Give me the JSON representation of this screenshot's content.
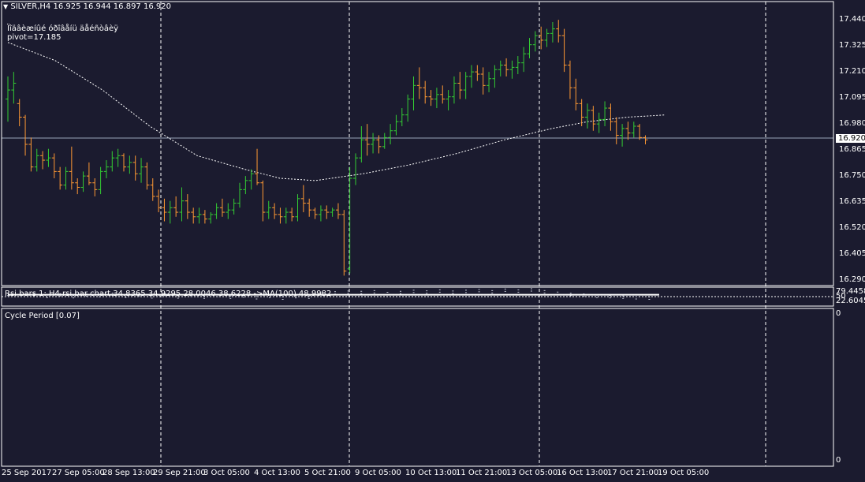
{
  "main_chart": {
    "header": "SILVER,H4  16.925 16.944 16.897 16.920",
    "indicator_name": "Ïîäâèæíûé óðîâåíü äåéñòâèÿ",
    "pivot_label": "pivot=17.185",
    "current_price": "16.920",
    "price_ticks": [
      "17.440",
      "17.325",
      "17.210",
      "17.095",
      "16.980",
      "16.865",
      "16.750",
      "16.635",
      "16.520",
      "16.405",
      "16.290"
    ]
  },
  "rsi_pane": {
    "label": "Rsi bars 1: H4  rsi bar chart 34.8365 34.9295 28.0046 38.6228  ->MA(100) 48.9982",
    "ticks": [
      "79.4458",
      "50",
      "22.6045"
    ]
  },
  "cycle_pane": {
    "label": "Cycle Period [0.07]",
    "ticks": [
      "0",
      "0"
    ]
  },
  "time_axis": [
    "25 Sep 2017",
    "27 Sep 05:00",
    "28 Sep 13:00",
    "29 Sep 21:00",
    "3 Oct 05:00",
    "4 Oct 13:00",
    "5 Oct 21:00",
    "9 Oct 05:00",
    "10 Oct 13:00",
    "11 Oct 21:00",
    "13 Oct 05:00",
    "16 Oct 13:00",
    "17 Oct 21:00",
    "19 Oct 05:00"
  ],
  "chart_data": {
    "type": "ohlc",
    "ylim": [
      16.29,
      17.47
    ],
    "up_color": "#33cc33",
    "down_color": "#ff9933",
    "bars": [
      [
        17.1,
        17.2,
        17.0,
        17.14
      ],
      [
        17.14,
        17.22,
        17.08,
        17.17
      ],
      [
        17.08,
        17.1,
        16.98,
        17.02
      ],
      [
        17.02,
        17.03,
        16.85,
        16.9
      ],
      [
        16.9,
        16.93,
        16.78,
        16.8
      ],
      [
        16.8,
        16.88,
        16.78,
        16.85
      ],
      [
        16.85,
        16.87,
        16.79,
        16.83
      ],
      [
        16.83,
        16.88,
        16.8,
        16.84
      ],
      [
        16.84,
        16.86,
        16.75,
        16.78
      ],
      [
        16.78,
        16.8,
        16.7,
        16.72
      ],
      [
        16.72,
        16.8,
        16.7,
        16.78
      ],
      [
        16.78,
        16.89,
        16.7,
        16.73
      ],
      [
        16.73,
        16.75,
        16.68,
        16.71
      ],
      [
        16.71,
        16.78,
        16.69,
        16.76
      ],
      [
        16.76,
        16.82,
        16.72,
        16.73
      ],
      [
        16.73,
        16.75,
        16.67,
        16.7
      ],
      [
        16.7,
        16.8,
        16.68,
        16.78
      ],
      [
        16.78,
        16.83,
        16.75,
        16.8
      ],
      [
        16.8,
        16.87,
        16.78,
        16.84
      ],
      [
        16.84,
        16.88,
        16.8,
        16.85
      ],
      [
        16.85,
        16.86,
        16.78,
        16.8
      ],
      [
        16.8,
        16.85,
        16.77,
        16.82
      ],
      [
        16.82,
        16.85,
        16.74,
        16.77
      ],
      [
        16.77,
        16.84,
        16.73,
        16.8
      ],
      [
        16.8,
        16.82,
        16.7,
        16.72
      ],
      [
        16.72,
        16.75,
        16.65,
        16.67
      ],
      [
        16.67,
        16.7,
        16.6,
        16.62
      ],
      [
        16.62,
        16.66,
        16.56,
        16.6
      ],
      [
        16.6,
        16.65,
        16.55,
        16.62
      ],
      [
        16.62,
        16.67,
        16.58,
        16.6
      ],
      [
        16.6,
        16.71,
        16.56,
        16.65
      ],
      [
        16.65,
        16.68,
        16.57,
        16.6
      ],
      [
        16.6,
        16.62,
        16.55,
        16.58
      ],
      [
        16.58,
        16.62,
        16.55,
        16.59
      ],
      [
        16.59,
        16.61,
        16.55,
        16.57
      ],
      [
        16.57,
        16.6,
        16.55,
        16.59
      ],
      [
        16.59,
        16.64,
        16.57,
        16.62
      ],
      [
        16.62,
        16.66,
        16.58,
        16.6
      ],
      [
        16.6,
        16.64,
        16.57,
        16.61
      ],
      [
        16.61,
        16.66,
        16.59,
        16.64
      ],
      [
        16.64,
        16.73,
        16.62,
        16.7
      ],
      [
        16.7,
        16.76,
        16.68,
        16.74
      ],
      [
        16.74,
        16.79,
        16.7,
        16.77
      ],
      [
        16.77,
        16.88,
        16.72,
        16.73
      ],
      [
        16.73,
        16.74,
        16.56,
        16.6
      ],
      [
        16.6,
        16.65,
        16.57,
        16.62
      ],
      [
        16.62,
        16.64,
        16.57,
        16.59
      ],
      [
        16.59,
        16.62,
        16.55,
        16.58
      ],
      [
        16.58,
        16.62,
        16.55,
        16.6
      ],
      [
        16.6,
        16.62,
        16.56,
        16.58
      ],
      [
        16.58,
        16.68,
        16.56,
        16.66
      ],
      [
        16.66,
        16.72,
        16.6,
        16.64
      ],
      [
        16.64,
        16.66,
        16.58,
        16.61
      ],
      [
        16.61,
        16.62,
        16.57,
        16.59
      ],
      [
        16.59,
        16.63,
        16.56,
        16.61
      ],
      [
        16.61,
        16.63,
        16.57,
        16.6
      ],
      [
        16.6,
        16.62,
        16.58,
        16.61
      ],
      [
        16.61,
        16.64,
        16.57,
        16.59
      ],
      [
        16.59,
        16.61,
        16.32,
        16.34
      ],
      [
        16.35,
        16.8,
        16.33,
        16.75
      ],
      [
        16.75,
        16.86,
        16.72,
        16.84
      ],
      [
        16.84,
        16.98,
        16.82,
        16.92
      ],
      [
        16.92,
        16.99,
        16.85,
        16.9
      ],
      [
        16.9,
        16.95,
        16.86,
        16.92
      ],
      [
        16.92,
        16.94,
        16.86,
        16.89
      ],
      [
        16.89,
        16.95,
        16.88,
        16.93
      ],
      [
        16.93,
        16.99,
        16.9,
        16.96
      ],
      [
        16.96,
        17.03,
        16.94,
        17.0
      ],
      [
        17.0,
        17.06,
        16.98,
        17.03
      ],
      [
        17.03,
        17.12,
        17.0,
        17.1
      ],
      [
        17.1,
        17.2,
        17.05,
        17.16
      ],
      [
        17.16,
        17.24,
        17.1,
        17.15
      ],
      [
        17.15,
        17.18,
        17.08,
        17.11
      ],
      [
        17.11,
        17.14,
        17.07,
        17.1
      ],
      [
        17.1,
        17.15,
        17.06,
        17.12
      ],
      [
        17.12,
        17.16,
        17.08,
        17.1
      ],
      [
        17.1,
        17.14,
        17.05,
        17.11
      ],
      [
        17.11,
        17.2,
        17.08,
        17.17
      ],
      [
        17.17,
        17.22,
        17.1,
        17.14
      ],
      [
        17.14,
        17.22,
        17.1,
        17.2
      ],
      [
        17.2,
        17.25,
        17.15,
        17.22
      ],
      [
        17.22,
        17.25,
        17.18,
        17.21
      ],
      [
        17.21,
        17.24,
        17.12,
        17.16
      ],
      [
        17.16,
        17.22,
        17.13,
        17.19
      ],
      [
        17.19,
        17.25,
        17.15,
        17.23
      ],
      [
        17.23,
        17.27,
        17.2,
        17.25
      ],
      [
        17.25,
        17.28,
        17.2,
        17.23
      ],
      [
        17.23,
        17.27,
        17.19,
        17.24
      ],
      [
        17.24,
        17.29,
        17.21,
        17.26
      ],
      [
        17.26,
        17.33,
        17.22,
        17.3
      ],
      [
        17.3,
        17.37,
        17.28,
        17.34
      ],
      [
        17.34,
        17.4,
        17.31,
        17.38
      ],
      [
        17.38,
        17.42,
        17.32,
        17.36
      ],
      [
        17.36,
        17.41,
        17.33,
        17.39
      ],
      [
        17.39,
        17.44,
        17.35,
        17.41
      ],
      [
        17.41,
        17.45,
        17.35,
        17.38
      ],
      [
        17.38,
        17.41,
        17.22,
        17.25
      ],
      [
        17.25,
        17.27,
        17.1,
        17.15
      ],
      [
        17.15,
        17.19,
        17.05,
        17.08
      ],
      [
        17.08,
        17.1,
        16.98,
        17.02
      ],
      [
        17.02,
        17.08,
        16.97,
        17.05
      ],
      [
        17.05,
        17.07,
        16.96,
        16.99
      ],
      [
        16.99,
        17.04,
        16.95,
        17.01
      ],
      [
        17.01,
        17.09,
        16.98,
        17.06
      ],
      [
        17.06,
        17.08,
        16.96,
        17.0
      ],
      [
        17.0,
        17.02,
        16.9,
        16.94
      ],
      [
        16.94,
        16.99,
        16.89,
        16.97
      ],
      [
        16.97,
        17.0,
        16.92,
        16.95
      ],
      [
        16.95,
        17.0,
        16.93,
        16.98
      ],
      [
        16.98,
        16.99,
        16.92,
        16.93
      ],
      [
        16.93,
        16.94,
        16.9,
        16.92
      ]
    ],
    "moving_average": [
      [
        0,
        17.35
      ],
      [
        20,
        17.27
      ],
      [
        40,
        17.14
      ],
      [
        60,
        16.98
      ],
      [
        80,
        16.85
      ],
      [
        100,
        16.79
      ],
      [
        115,
        16.75
      ],
      [
        130,
        16.74
      ],
      [
        150,
        16.77
      ],
      [
        170,
        16.81
      ],
      [
        190,
        16.86
      ],
      [
        210,
        16.92
      ],
      [
        230,
        16.97
      ],
      [
        245,
        17.0
      ],
      [
        262,
        17.02
      ],
      [
        278,
        17.03
      ]
    ],
    "rsi_bars": [
      [
        0.5,
        0.7
      ],
      [
        0.45,
        0.65
      ],
      [
        0.48,
        0.7
      ],
      [
        0.42,
        0.6
      ],
      [
        0.46,
        0.68
      ],
      [
        0.4,
        0.58
      ],
      [
        0.44,
        0.66
      ],
      [
        0.41,
        0.63
      ],
      [
        0.47,
        0.71
      ],
      [
        0.39,
        0.6
      ],
      [
        0.43,
        0.66
      ],
      [
        0.38,
        0.57
      ],
      [
        0.45,
        0.7
      ],
      [
        0.37,
        0.56
      ],
      [
        0.42,
        0.65
      ],
      [
        0.36,
        0.55
      ],
      [
        0.41,
        0.64
      ],
      [
        0.35,
        0.55
      ],
      [
        0.4,
        0.62
      ],
      [
        0.34,
        0.52
      ],
      [
        0.39,
        0.6
      ],
      [
        0.3,
        0.5
      ],
      [
        0.36,
        0.58
      ],
      [
        0.33,
        0.55
      ],
      [
        0.5,
        0.72
      ],
      [
        0.55,
        0.78
      ],
      [
        0.6,
        0.82
      ],
      [
        0.58,
        0.8
      ],
      [
        0.62,
        0.84
      ],
      [
        0.55,
        0.75
      ],
      [
        0.6,
        0.8
      ],
      [
        0.64,
        0.86
      ],
      [
        0.62,
        0.83
      ],
      [
        0.66,
        0.88
      ],
      [
        0.6,
        0.82
      ],
      [
        0.65,
        0.86
      ],
      [
        0.68,
        0.9
      ],
      [
        0.63,
        0.84
      ],
      [
        0.69,
        0.92
      ],
      [
        0.66,
        0.88
      ],
      [
        0.7,
        0.94
      ],
      [
        0.62,
        0.84
      ],
      [
        0.55,
        0.76
      ],
      [
        0.5,
        0.7
      ],
      [
        0.45,
        0.66
      ],
      [
        0.4,
        0.6
      ],
      [
        0.38,
        0.58
      ],
      [
        0.35,
        0.55
      ],
      [
        0.33,
        0.52
      ],
      [
        0.3,
        0.5
      ]
    ],
    "rsi_ma": 0.6
  }
}
